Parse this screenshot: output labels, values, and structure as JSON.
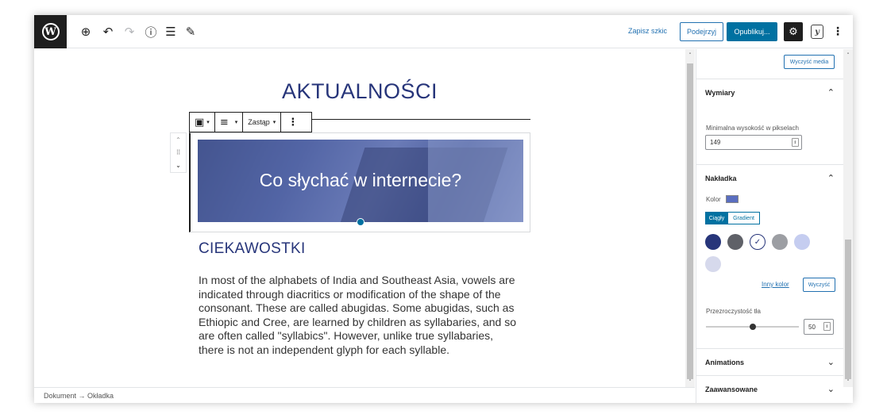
{
  "topbar": {
    "save_draft": "Zapisz szkic",
    "preview": "Podejrzyj",
    "publish": "Opublikuj...",
    "icons": [
      "wordpress-logo",
      "add-block-icon",
      "undo-icon",
      "redo-icon",
      "info-icon",
      "list-view-icon",
      "edit-tool-icon",
      "settings-gear-icon",
      "yoast-icon",
      "more-options-icon"
    ],
    "wp_glyph": "W",
    "add_glyph": "⊕",
    "undo_glyph": "↶",
    "redo_glyph": "↷",
    "info_glyph": "ⓘ",
    "list_glyph": "☰",
    "pen_glyph": "✎",
    "gear_glyph": "⚙",
    "yoast_glyph": "y",
    "more_glyph": "⋮"
  },
  "editor": {
    "page_title": "AKTUALNOŚCI",
    "block_toolbar": {
      "replace": "Zastąp",
      "caret": "▾",
      "align_glyph": "≡",
      "media_glyph": "▣",
      "more_glyph": "⋮"
    },
    "mover": {
      "up": "⌃",
      "drag": "⠿",
      "down": "⌄"
    },
    "cover_text": "Co słychać w internecie?",
    "heading": "CIEKAWOSTKI",
    "paragraph": "In most of the alphabets of India and Southeast Asia, vowels are indicated through diacritics or modification of the shape of the consonant. These are called abugidas. Some abugidas, such as Ethiopic and Cree, are learned by children as syllabaries, and so are often called \"syllabics\". However, unlike true syllabaries, there is not an independent glyph for each syllable."
  },
  "breadcrumb": "Dokument → Okładka",
  "scroll": {
    "up": "˄",
    "down": "˅"
  },
  "sidebar": {
    "clear_media": "Wyczyść media",
    "panels": {
      "dimensions": "Wymiary",
      "overlay": "Nakładka",
      "animations": "Animations",
      "advanced": "Zaawansowane"
    },
    "chevron_up": "⌃",
    "chevron_down": "⌄",
    "min_height_label": "Minimalna wysokość w pikselach",
    "min_height_value": "149",
    "spin_glyph": "⇕",
    "color_label": "Kolor",
    "solid": "Ciągły",
    "gradient": "Gradient",
    "swatches": [
      "#27357a",
      "#5f6168",
      "#ffffff",
      "#9c9ea3",
      "#c5cdf0",
      "#d6d9ec"
    ],
    "check_glyph": "✓",
    "other_color": "Inny kolor",
    "clear": "Wyczyść",
    "opacity_label": "Przezroczystość tła",
    "opacity_value": "50",
    "opacity_fraction": 0.5
  }
}
